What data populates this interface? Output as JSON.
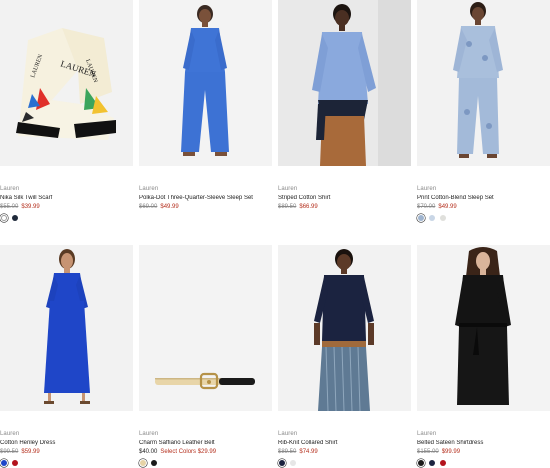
{
  "products": [
    {
      "brand": "Lauren",
      "name": "Nika Silk Twill Scarf",
      "original_price": "$55.00",
      "sale_price": "$39.99",
      "current_price": "",
      "sale_label": "",
      "swatches": [
        "#ffffff",
        "#1f2a3a"
      ]
    },
    {
      "brand": "Lauren",
      "name": "Polka-Dot Three-Quarter-Sleeve Sleep Set",
      "original_price": "$69.00",
      "sale_price": "$49.99",
      "current_price": "",
      "sale_label": "",
      "swatches": []
    },
    {
      "brand": "Lauren",
      "name": "Striped Cotton Shirt",
      "original_price": "$89.50",
      "sale_price": "$66.99",
      "current_price": "",
      "sale_label": "",
      "swatches": []
    },
    {
      "brand": "Lauren",
      "name": "Print Cotton-Blend Sleep Set",
      "original_price": "$70.00",
      "sale_price": "$49.99",
      "current_price": "",
      "sale_label": "",
      "swatches": [
        "#9fb4cf",
        "#c9d6e6",
        "#e0e0dc"
      ]
    },
    {
      "brand": "Lauren",
      "name": "Cotton Henley Dress",
      "original_price": "$99.50",
      "sale_price": "$59.99",
      "current_price": "",
      "sale_label": "",
      "swatches": [
        "#1f46c8",
        "#b3121c"
      ]
    },
    {
      "brand": "Lauren",
      "name": "Charm Saffiano Leather Belt",
      "original_price": "",
      "sale_price": "",
      "current_price": "$40.00",
      "sale_label": "Select Colors $29.99",
      "swatches": [
        "#e6d3a6",
        "#1a1a1a"
      ]
    },
    {
      "brand": "Lauren",
      "name": "Rib-Knit Collared Shirt",
      "original_price": "$89.50",
      "sale_price": "$74.99",
      "current_price": "",
      "sale_label": "",
      "swatches": [
        "#1b2340",
        "#e6e6e6"
      ]
    },
    {
      "brand": "Lauren",
      "name": "Belted Sateen Shirtdress",
      "original_price": "$155.00",
      "sale_price": "$99.99",
      "current_price": "",
      "sale_label": "",
      "swatches": [
        "#1a1a1a",
        "#1b2340",
        "#b3121c"
      ]
    }
  ],
  "icons": {
    "scarf": "silk-scarf-image",
    "belt": "leather-belt-image",
    "model": "model-photo"
  }
}
